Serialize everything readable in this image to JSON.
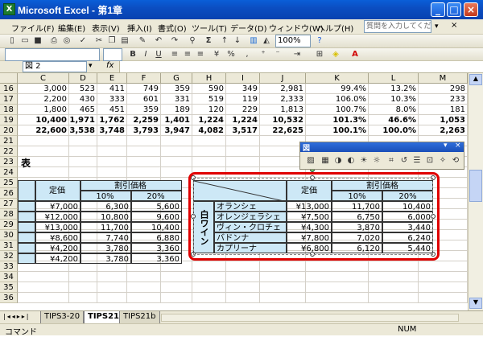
{
  "window": {
    "title": "Microsoft Excel - 第1章",
    "app_icon": "excel-icon"
  },
  "menu": {
    "items": [
      "ファイル(F)",
      "編集(E)",
      "表示(V)",
      "挿入(I)",
      "書式(O)",
      "ツール(T)",
      "データ(D)",
      "ウィンドウ(W)",
      "ヘルプ(H)"
    ],
    "ask_placeholder": "質問を入力してください"
  },
  "toolbar": {
    "zoom": "100%",
    "sum_icon": "Σ"
  },
  "formula_bar": {
    "name_box": "図 2",
    "fx": "fx"
  },
  "grid": {
    "columns": [
      "C",
      "D",
      "E",
      "F",
      "G",
      "H",
      "I",
      "J",
      "K",
      "L",
      "M"
    ],
    "rows": [
      {
        "n": "16",
        "cells": [
          "3,000",
          "523",
          "411",
          "749",
          "359",
          "590",
          "349",
          "2,981",
          "99.4%",
          "13.2%",
          "298"
        ]
      },
      {
        "n": "17",
        "cells": [
          "2,200",
          "430",
          "333",
          "601",
          "331",
          "519",
          "119",
          "2,333",
          "106.0%",
          "10.3%",
          "233"
        ]
      },
      {
        "n": "18",
        "cells": [
          "1,800",
          "465",
          "451",
          "359",
          "189",
          "120",
          "229",
          "1,813",
          "100.7%",
          "8.0%",
          "181"
        ]
      },
      {
        "n": "19",
        "cells": [
          "10,400",
          "1,971",
          "1,762",
          "2,259",
          "1,401",
          "1,224",
          "1,224",
          "10,532",
          "101.3%",
          "46.6%",
          "1,053"
        ]
      },
      {
        "n": "20",
        "cells": [
          "22,600",
          "3,538",
          "3,748",
          "3,793",
          "3,947",
          "4,082",
          "3,517",
          "22,625",
          "100.1%",
          "100.0%",
          "2,263"
        ]
      }
    ],
    "empty_rows": [
      "21",
      "22",
      "23",
      "24",
      "25",
      "26",
      "27",
      "28",
      "29",
      "30",
      "31",
      "32",
      "33",
      "34",
      "35",
      "36"
    ],
    "label_b23": "表"
  },
  "left_table": {
    "header_price": "定価",
    "header_discount": "割引価格",
    "pct": [
      "10%",
      "20%"
    ],
    "rows": [
      [
        "¥7,000",
        "6,300",
        "5,600"
      ],
      [
        "¥12,000",
        "10,800",
        "9,600"
      ],
      [
        "¥13,000",
        "11,700",
        "10,400"
      ],
      [
        "¥8,600",
        "7,740",
        "6,880"
      ],
      [
        "¥4,200",
        "3,780",
        "3,360"
      ],
      [
        "¥4,200",
        "3,780",
        "3,360"
      ]
    ]
  },
  "right_table": {
    "header_price": "定価",
    "header_discount": "割引価格",
    "pct": [
      "10%",
      "20%"
    ],
    "category": "白ワイン",
    "rows": [
      {
        "name": "オランシェ",
        "price": "¥13,000",
        "d10": "11,700",
        "d20": "10,400"
      },
      {
        "name": "オレンジェラシェ",
        "price": "¥7,500",
        "d10": "6,750",
        "d20": "6,000"
      },
      {
        "name": "ヴィン・クロチェ",
        "price": "¥4,300",
        "d10": "3,870",
        "d20": "3,440"
      },
      {
        "name": "バドンナ",
        "price": "¥7,800",
        "d10": "7,020",
        "d20": "6,240"
      },
      {
        "name": "カプリーナ",
        "price": "¥6,800",
        "d10": "6,120",
        "d20": "5,440"
      }
    ]
  },
  "picture_toolbar": {
    "title": "図"
  },
  "sheet_tabs": [
    "TIPS3-20",
    "TIPS21a",
    "TIPS21b"
  ],
  "active_tab": "TIPS21a",
  "status": {
    "left": "コマンド",
    "right": "NUM"
  },
  "colors": {
    "selection_red": "#e00000",
    "cell_blue": "#cde8f6"
  }
}
